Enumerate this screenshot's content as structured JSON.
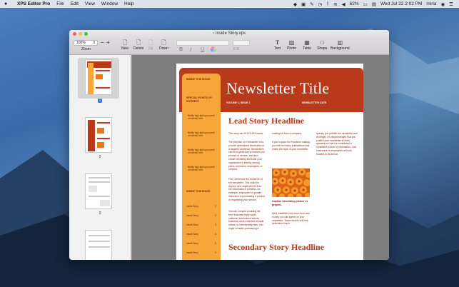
{
  "menubar": {
    "apple": "",
    "app_name": "XPS Editor Pro",
    "menus": [
      "File",
      "Edit",
      "View",
      "Window",
      "Help"
    ],
    "battery": "62%",
    "clock": "Wed Jul 22  2:02 PM",
    "user": "miria"
  },
  "window": {
    "title": "Inside Story.xps"
  },
  "toolbar": {
    "zoom_value": "100%",
    "zoom_label": "Zoom",
    "zoom_minus": "−",
    "zoom_plus": "+",
    "new_label": "New",
    "delete_label": "Delete",
    "up_label": "Up",
    "down_label": "Down",
    "bold": "B",
    "italic": "I",
    "underline": "U",
    "text_label": "Text",
    "photo_label": "Photo",
    "table_label": "Table",
    "shape_label": "Shape",
    "background_label": "Background"
  },
  "sidebar": {
    "pages": [
      "1",
      "2",
      "3"
    ],
    "selected": "1"
  },
  "document": {
    "newsletter_title": "Newsletter Title",
    "volume": "VOLUME 1, ISSUE 1",
    "date": "NEWSLETTER DATE",
    "side_inside": "INSIDE THIS ISSUE:",
    "side_special": "SPECIAL POINTS OF INTEREST:",
    "side_bullets": [
      "Briefly high-light your point of interest here.",
      "Briefly high-light your point of interest here.",
      "Briefly high-light your point of interest here.",
      "Briefly high-light your point of interest here."
    ],
    "side_issue": "INSIDE THIS ISSUE:",
    "side_rows": [
      [
        "Inside Story",
        "2"
      ],
      [
        "Inside Story",
        "2"
      ],
      [
        "Inside Story",
        "3"
      ],
      [
        "Inside Story",
        "4"
      ],
      [
        "Inside Story",
        "5"
      ],
      [
        "Inside Story",
        "6"
      ]
    ],
    "lead_headline": "Lead Story Headline",
    "secondary_headline": "Secondary Story Headline",
    "col1_p1": "This story can fit 175-225 words.",
    "col1_p2": "The purpose of a newsletter is to provide specialized information to a targeted audience. Newsletters can be a great way to market your product or service, and also create credibility and build your organization's identity among peers, members, employees, or vendors.",
    "col1_p3": "First, determine the audience of the newsletter. This could be anyone who might benefit from the information it contains, for example, employees or people interested in purchasing a product or requesting your service.",
    "col1_p4": "You can compile a mailing list from business reply cards, customer information sheets, business cards collected at trade shows, or membership lists. You might consider purchasing a",
    "col2_p1": "mailing list from a company.",
    "col2_p2": "If you explore the Publisher catalog, you will find many publications that match the style of your newsletter.",
    "col2_caption": "Caption describing picture or graphic.",
    "col2_p3": "Next, establish how much time and money you can spend on your newsletter. These factors will help determine how fr",
    "col3_p1": "quently you publish the newsletter and its length. It's recommended that you publish your newsletter at least quarterly so that it's considered a consistent source of information. Your customers or employees will look forward to its arrival."
  },
  "colors": {
    "banner": "#b83a1a",
    "sidebar_orange": "#f7a63a",
    "selection_blue": "#2a6fd6"
  }
}
